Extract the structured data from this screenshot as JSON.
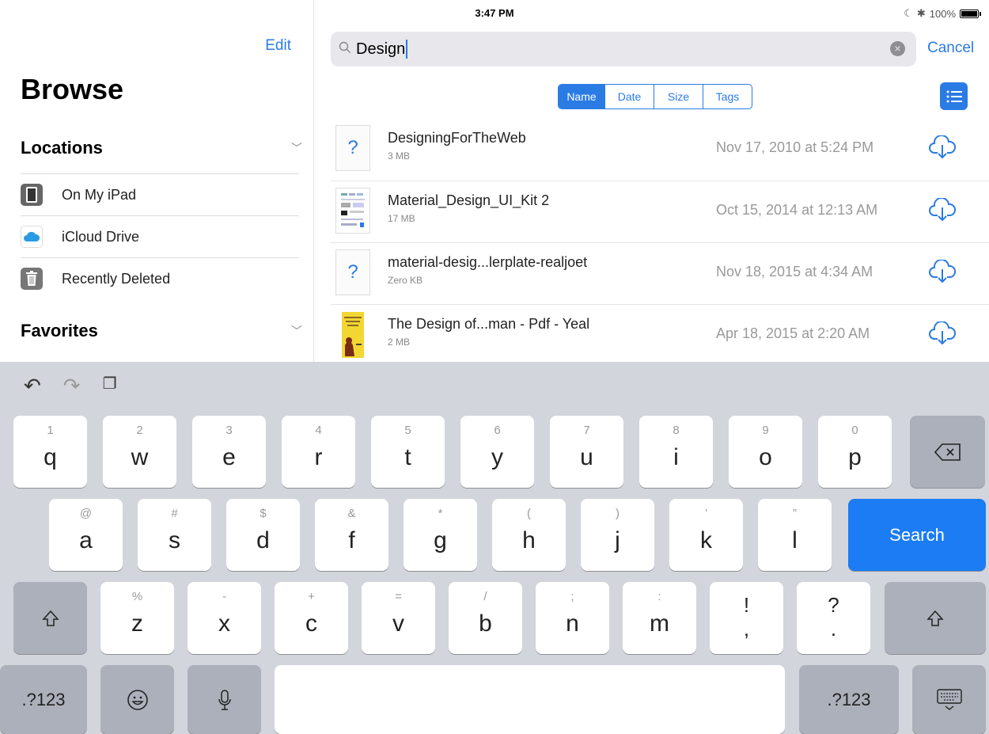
{
  "status_bar": {
    "device": "iPad",
    "time": "3:47 PM",
    "battery": "100%"
  },
  "sidebar": {
    "edit_label": "Edit",
    "title": "Browse",
    "locations_header": "Locations",
    "locations": [
      {
        "label": "On My iPad",
        "icon": "ipad-icon"
      },
      {
        "label": "iCloud Drive",
        "icon": "icloud-icon"
      },
      {
        "label": "Recently Deleted",
        "icon": "trash-icon"
      }
    ],
    "favorites_header": "Favorites"
  },
  "search": {
    "value": "Design",
    "cancel_label": "Cancel"
  },
  "sort": {
    "options": [
      "Name",
      "Date",
      "Size",
      "Tags"
    ],
    "selected": "Name"
  },
  "files": [
    {
      "name": "DesigningForTheWeb",
      "size": "3 MB",
      "date": "Nov 17, 2010 at 5:24 PM",
      "thumb": "unknown-file-icon"
    },
    {
      "name": "Material_Design_UI_Kit 2",
      "size": "17 MB",
      "date": "Oct 15, 2014 at 12:13 AM",
      "thumb": "ui-kit-thumbnail"
    },
    {
      "name": "material-desig...lerplate-realjoet",
      "size": "Zero KB",
      "date": "Nov 18, 2015 at 4:34 AM",
      "thumb": "unknown-file-icon"
    },
    {
      "name": "The Design of...man - Pdf - Yeal",
      "size": "2 MB",
      "date": "Apr 18, 2015 at 2:20 AM",
      "thumb": "book-cover-thumbnail"
    }
  ],
  "keyboard": {
    "row1": [
      {
        "main": "q",
        "sub": "1"
      },
      {
        "main": "w",
        "sub": "2"
      },
      {
        "main": "e",
        "sub": "3"
      },
      {
        "main": "r",
        "sub": "4"
      },
      {
        "main": "t",
        "sub": "5"
      },
      {
        "main": "y",
        "sub": "6"
      },
      {
        "main": "u",
        "sub": "7"
      },
      {
        "main": "i",
        "sub": "8"
      },
      {
        "main": "o",
        "sub": "9"
      },
      {
        "main": "p",
        "sub": "0"
      }
    ],
    "row2": [
      {
        "main": "a",
        "sub": "@"
      },
      {
        "main": "s",
        "sub": "#"
      },
      {
        "main": "d",
        "sub": "$"
      },
      {
        "main": "f",
        "sub": "&"
      },
      {
        "main": "g",
        "sub": "*"
      },
      {
        "main": "h",
        "sub": "("
      },
      {
        "main": "j",
        "sub": ")"
      },
      {
        "main": "k",
        "sub": "’"
      },
      {
        "main": "l",
        "sub": "”"
      }
    ],
    "row3": [
      {
        "main": "z",
        "sub": "%"
      },
      {
        "main": "x",
        "sub": "-"
      },
      {
        "main": "c",
        "sub": "+"
      },
      {
        "main": "v",
        "sub": "="
      },
      {
        "main": "b",
        "sub": "/"
      },
      {
        "main": "n",
        "sub": ";"
      },
      {
        "main": "m",
        "sub": ":"
      }
    ],
    "punct_keys": [
      {
        "top": "!",
        "bottom": ","
      },
      {
        "top": "?",
        "bottom": "."
      }
    ],
    "search_label": "Search",
    "numbers_label": ".?123"
  },
  "colors": {
    "accent": "#2a7be4",
    "search_key": "#1b7cf4"
  }
}
